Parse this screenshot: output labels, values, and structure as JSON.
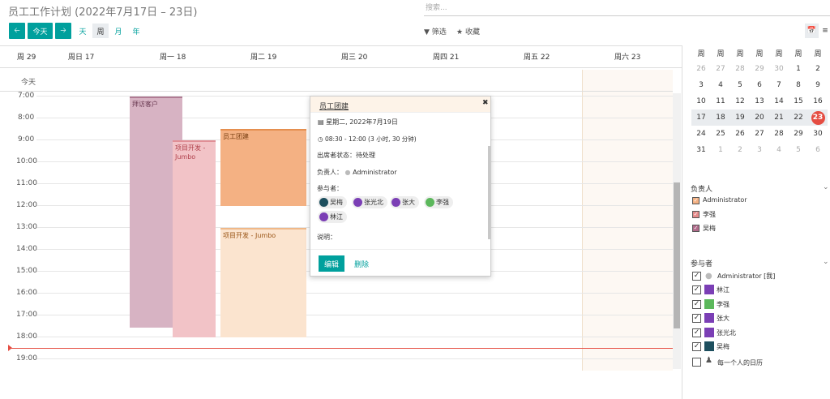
{
  "header": {
    "title": "员工工作计划 (2022年7月17日 – 23日)",
    "search_placeholder": "搜索...",
    "prev_icon": "arrow-left-icon",
    "next_icon": "arrow-right-icon",
    "today_label": "今天",
    "scales": [
      "天",
      "周",
      "月",
      "年"
    ],
    "active_scale": "周",
    "filter_label": "筛选",
    "favorite_label": "收藏"
  },
  "calendar": {
    "week_label": "周 29",
    "days": [
      "周日 17",
      "周一 18",
      "周二 19",
      "周三 20",
      "周四 21",
      "周五 22",
      "周六 23"
    ],
    "allday_label": "今天",
    "hours": [
      "7:00",
      "8:00",
      "9:00",
      "10:00",
      "11:00",
      "12:00",
      "13:00",
      "14:00",
      "15:00",
      "16:00",
      "17:00",
      "18:00",
      "19:00"
    ],
    "events": [
      {
        "title": "拜访客户",
        "color": "#d7b3c3"
      },
      {
        "title": "项目开发 - Jumbo",
        "color": "#f2c3c7"
      },
      {
        "title": "员工团建",
        "color": "#f4b183"
      },
      {
        "title": "项目开发 - Jumbo",
        "color": "#fbe4cf"
      }
    ]
  },
  "popover": {
    "title": "员工团建",
    "date": "星期二, 2022年7月19日",
    "time": "08:30 - 12:00 (3 小时, 30 分钟)",
    "status_label": "出席者状态：",
    "status_value": "待处理",
    "owner_label": "负责人：",
    "owner_value": "Administrator",
    "attendees_label": "参与者：",
    "attendees": [
      "吴梅",
      "张光北",
      "张大",
      "李强",
      "林江"
    ],
    "description_label": "说明：",
    "edit_label": "编辑",
    "delete_label": "删除"
  },
  "sidebar": {
    "minical_header": [
      "周",
      "周",
      "周",
      "周",
      "周",
      "周",
      "周"
    ],
    "minical_rows": [
      [
        "26",
        "27",
        "28",
        "29",
        "30",
        "1",
        "2"
      ],
      [
        "3",
        "4",
        "5",
        "6",
        "7",
        "8",
        "9"
      ],
      [
        "10",
        "11",
        "12",
        "13",
        "14",
        "15",
        "16"
      ],
      [
        "17",
        "18",
        "19",
        "20",
        "21",
        "22",
        "23"
      ],
      [
        "24",
        "25",
        "26",
        "27",
        "28",
        "29",
        "30"
      ],
      [
        "31",
        "1",
        "2",
        "3",
        "4",
        "5",
        "6"
      ]
    ],
    "owner_filter_title": "负责人",
    "owner_filters": [
      {
        "label": "Administrator",
        "color": "#f4b183"
      },
      {
        "label": "李强",
        "color": "#e58b8b"
      },
      {
        "label": "吴梅",
        "color": "#b06a8a"
      }
    ],
    "attendee_filter_title": "参与者",
    "attendee_filters": [
      "Administrator [我]",
      "林江",
      "李强",
      "张大",
      "张光北",
      "吴梅"
    ],
    "everyone_label": "每一个人的日历"
  }
}
